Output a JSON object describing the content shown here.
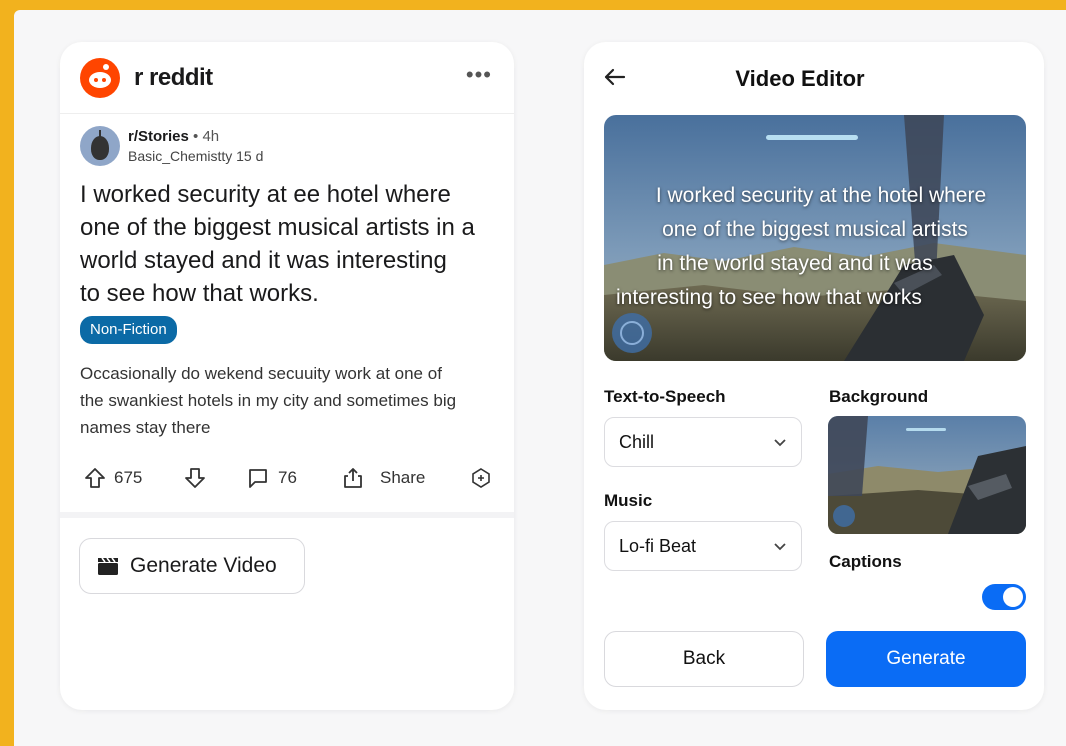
{
  "reddit": {
    "brand": "r reddit",
    "more": "•••",
    "subreddit": "r/Stories",
    "age": "• 4h",
    "author": "Basic_Chemistty 15 d",
    "title_lines": [
      "I worked security at ee hotel where",
      "one of the biggest musical artists in a",
      "world stayed and it was interesting",
      "to see how that works."
    ],
    "flair": "Non-Fiction",
    "body_lines": [
      "Occasionally do wekend secuuity work at one of",
      "the swankiest hotels in my city and sometimes big",
      "names stay there"
    ],
    "upvotes": "675",
    "comments": "76",
    "share": "Share",
    "generate_video": "Generate Video"
  },
  "editor": {
    "title": "Video Editor",
    "caption_lines": [
      "I worked security at the hotel where",
      "one of the biggest musical artists",
      "in the world stayed and it was",
      "interesting to see how that works"
    ],
    "tts_label": "Text-to-Speech",
    "tts_value": "Chill",
    "music_label": "Music",
    "music_value": "Lo-fi Beat",
    "background_label": "Background",
    "captions_label": "Captions",
    "captions_on": true,
    "back_button": "Back",
    "generate_button": "Generate"
  },
  "icons": {
    "logo": "reddit-logo",
    "upvote": "arrow-up-icon",
    "downvote": "arrow-down-icon",
    "comment": "comment-icon",
    "share": "share-icon",
    "award": "award-icon",
    "clapper": "clapperboard-icon",
    "back": "arrow-left-icon",
    "chevron": "chevron-down-icon"
  },
  "colors": {
    "page_background": "#f2b21e",
    "reddit_orange": "#ff4500",
    "flair": "#0b6aa6",
    "accent_blue": "#0a6cf5"
  }
}
